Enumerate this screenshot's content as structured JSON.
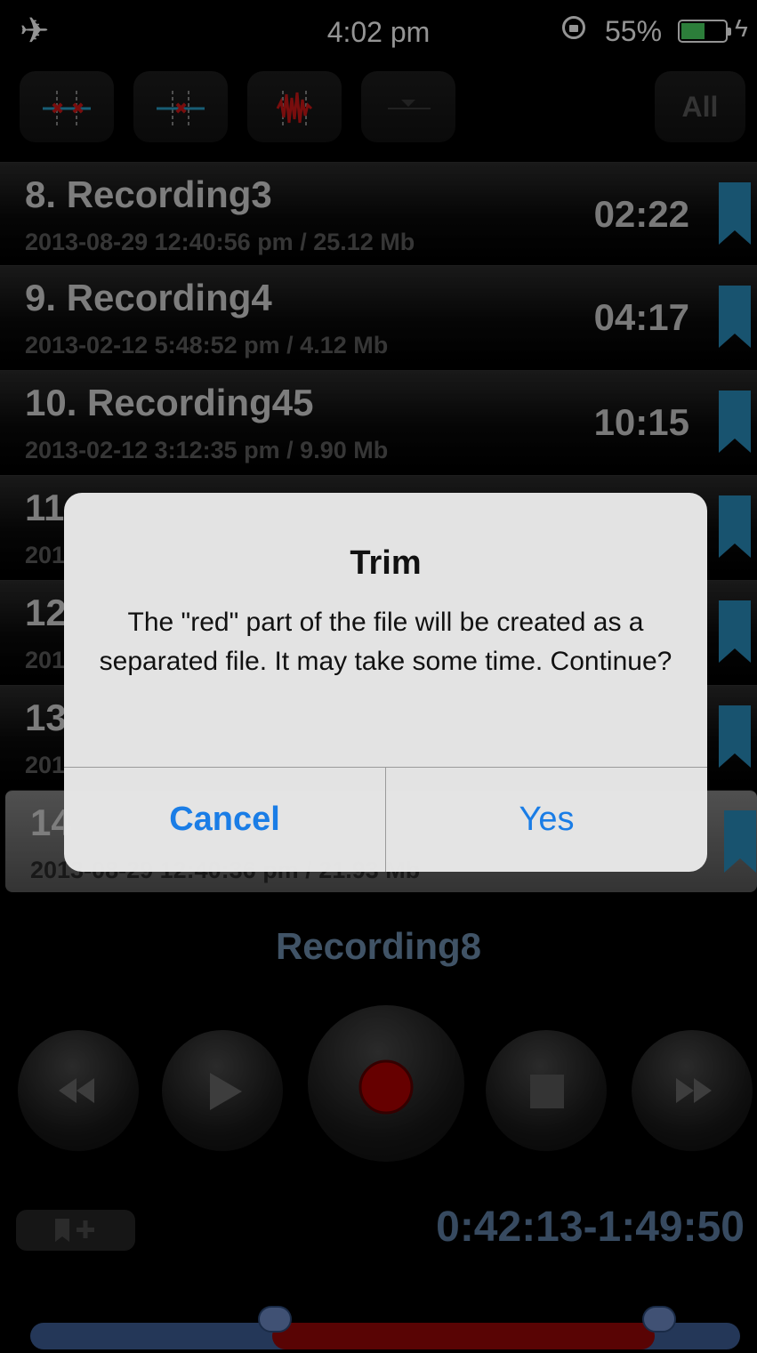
{
  "status": {
    "icon_airplane": "airplane-icon",
    "time": "4:02 pm",
    "icon_rotation_lock": "rotation-lock-icon",
    "battery_percent": "55%",
    "battery_level": 0.55,
    "icon_charging": "charging-icon"
  },
  "toolbar": {
    "buttons": [
      {
        "name": "trim-markers-icon"
      },
      {
        "name": "split-marker-icon"
      },
      {
        "name": "waveform-icon"
      },
      {
        "name": "dropdown-icon"
      }
    ],
    "all_label": "All"
  },
  "recordings": [
    {
      "title": "8. Recording3",
      "meta": "2013-08-29 12:40:56 pm / 25.12 Mb",
      "duration": "02:22"
    },
    {
      "title": "9. Recording4",
      "meta": "2013-02-12 5:48:52 pm / 4.12 Mb",
      "duration": "04:17"
    },
    {
      "title": "10. Recording45",
      "meta": "2013-02-12 3:12:35 pm / 9.90 Mb",
      "duration": "10:15"
    },
    {
      "title": "11",
      "meta": "201",
      "duration": ""
    },
    {
      "title": "12",
      "meta": "201",
      "duration": ""
    },
    {
      "title": "13",
      "meta": "201",
      "duration": ""
    },
    {
      "title": "14",
      "meta": "2013-08-29 12:40:36 pm / 21.93 Mb",
      "duration": ""
    }
  ],
  "now_playing": "Recording8",
  "transport": [
    "rewind-icon",
    "play-icon",
    "record-icon",
    "stop-icon",
    "fast-forward-icon"
  ],
  "time_range": "0:42:13-1:49:50",
  "colors": {
    "accent_blue": "#1a7de6",
    "bookmark": "#2a8fc0",
    "range_text": "#5f80a6",
    "selection_red": "#9a0707",
    "track_blue": "#3f5f98"
  },
  "alert": {
    "title": "Trim",
    "message": "The \"red\" part of the file will be created as a separated file. It may take some time. Continue?",
    "cancel": "Cancel",
    "confirm": "Yes"
  }
}
